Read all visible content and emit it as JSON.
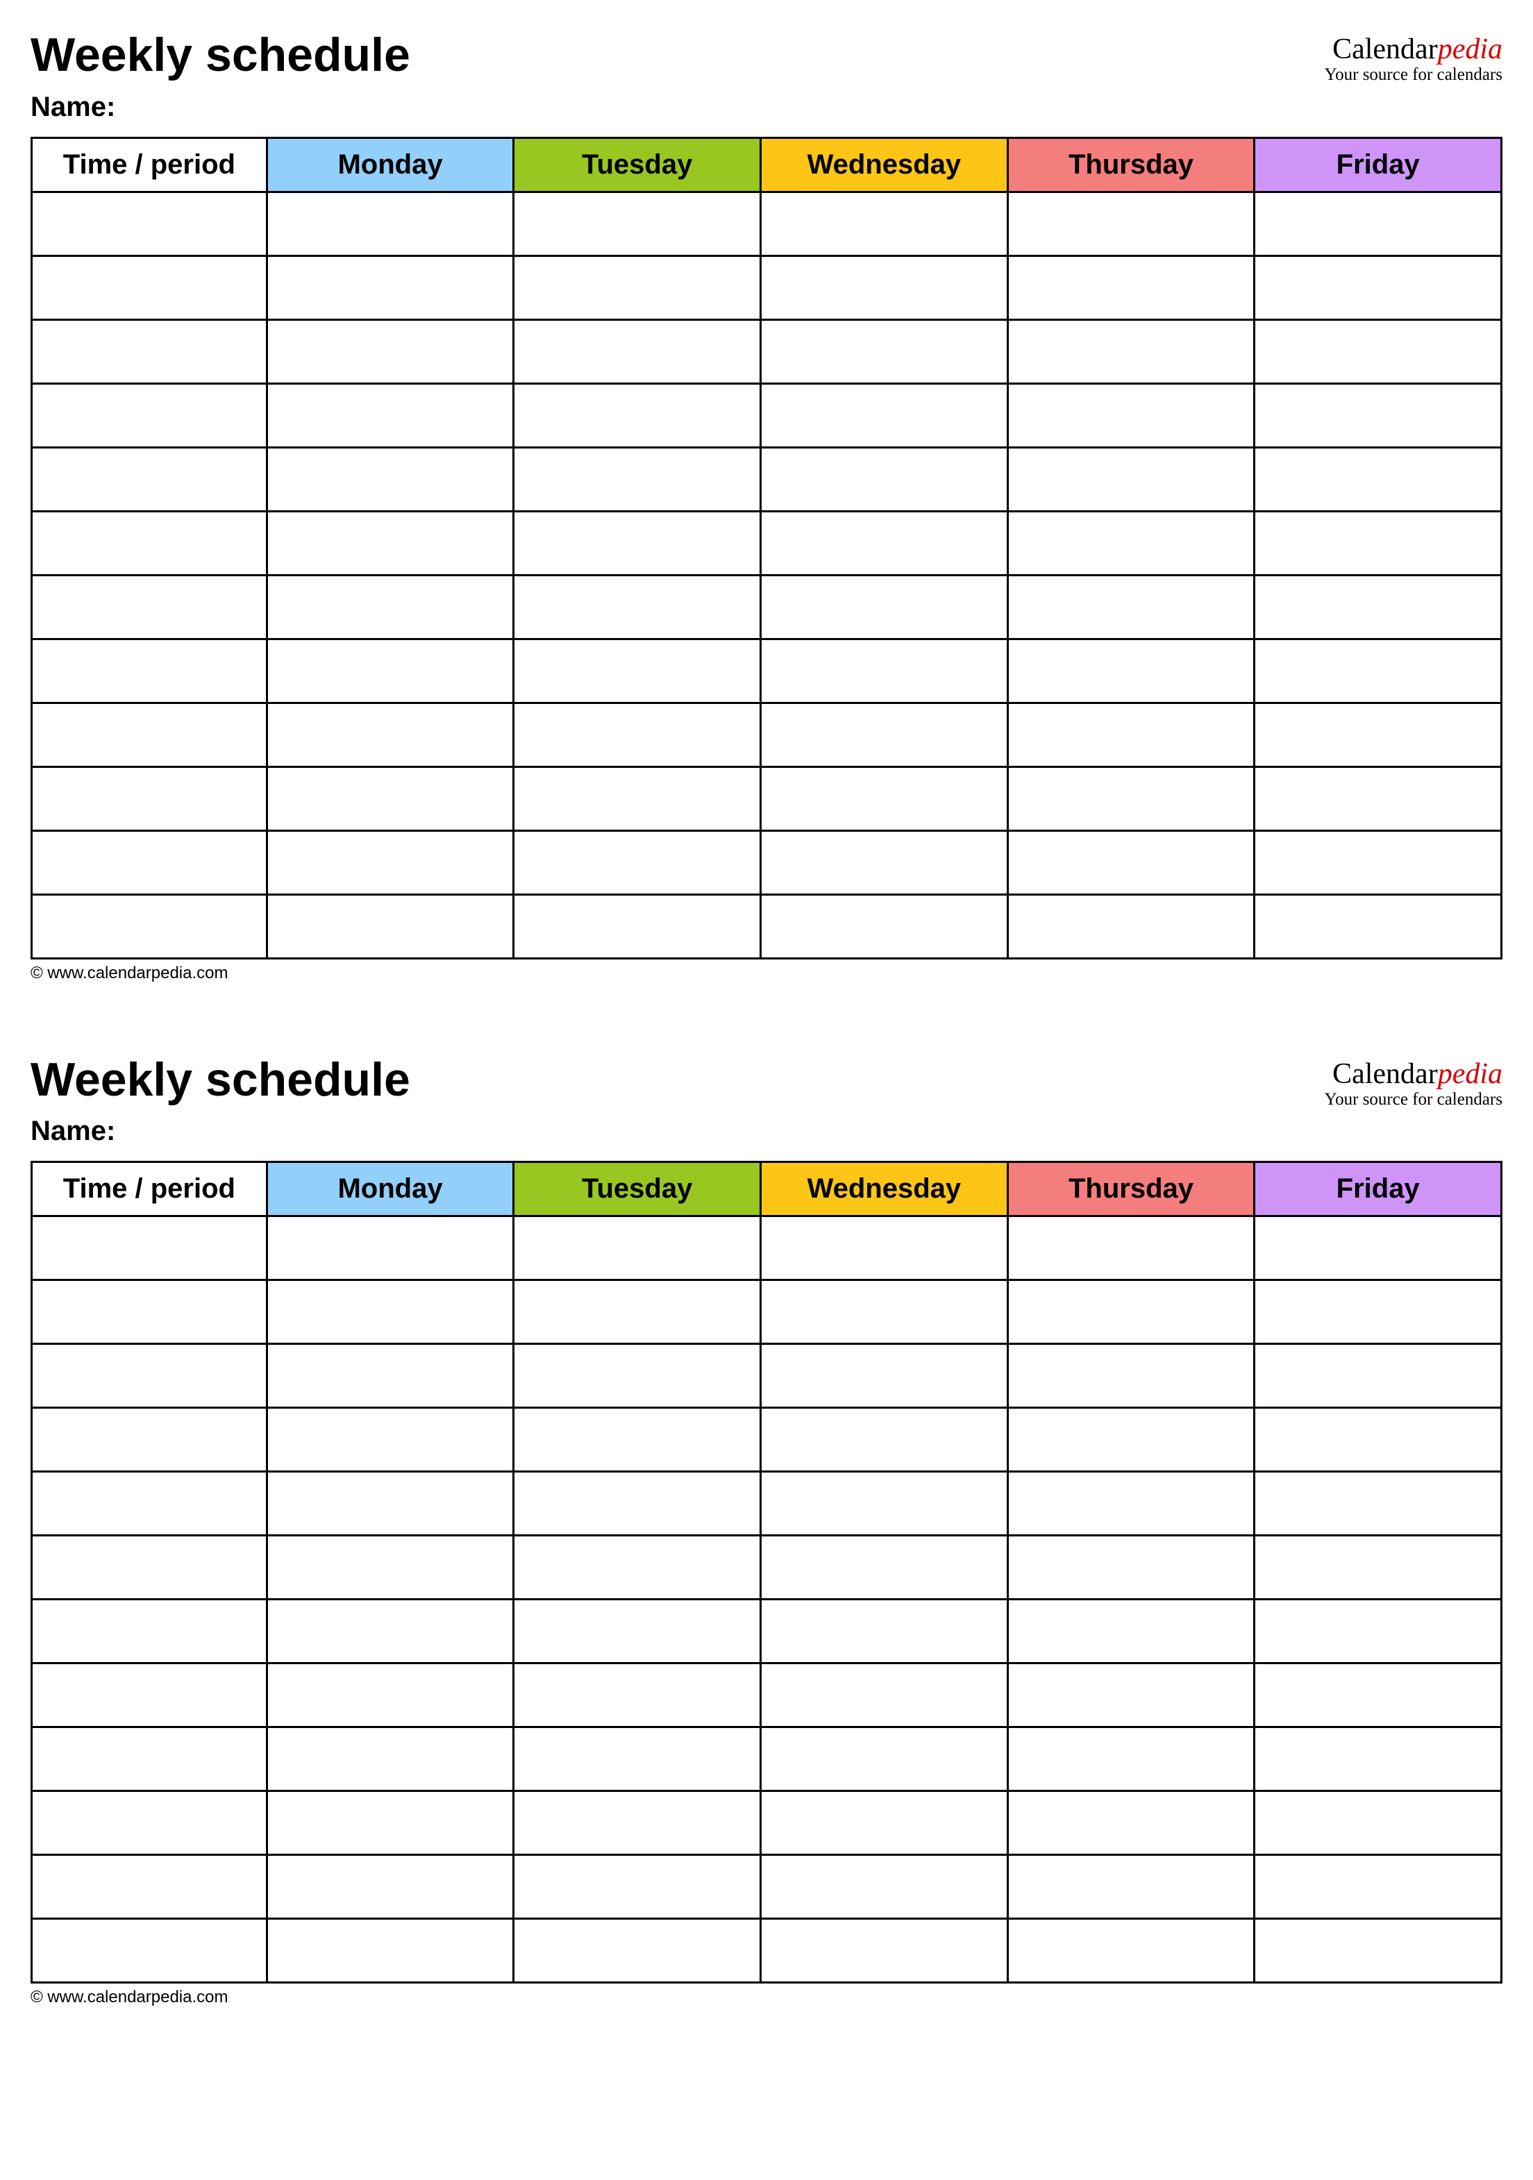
{
  "schedules": [
    {
      "title": "Weekly schedule",
      "logo_left": "Calendar",
      "logo_right": "pedia",
      "logo_tag": "Your source for calendars",
      "name_label": "Name:",
      "columns": [
        "Time / period",
        "Monday",
        "Tuesday",
        "Wednesday",
        "Thursday",
        "Friday"
      ],
      "rows": 12,
      "footer": "© www.calendarpedia.com"
    },
    {
      "title": "Weekly schedule",
      "logo_left": "Calendar",
      "logo_right": "pedia",
      "logo_tag": "Your source for calendars",
      "name_label": "Name:",
      "columns": [
        "Time / period",
        "Monday",
        "Tuesday",
        "Wednesday",
        "Thursday",
        "Friday"
      ],
      "rows": 12,
      "footer": "© www.calendarpedia.com"
    }
  ],
  "column_colors": [
    "#ffffff",
    "#92cff9",
    "#97c720",
    "#fdc515",
    "#f47d7d",
    "#ce94f7"
  ]
}
